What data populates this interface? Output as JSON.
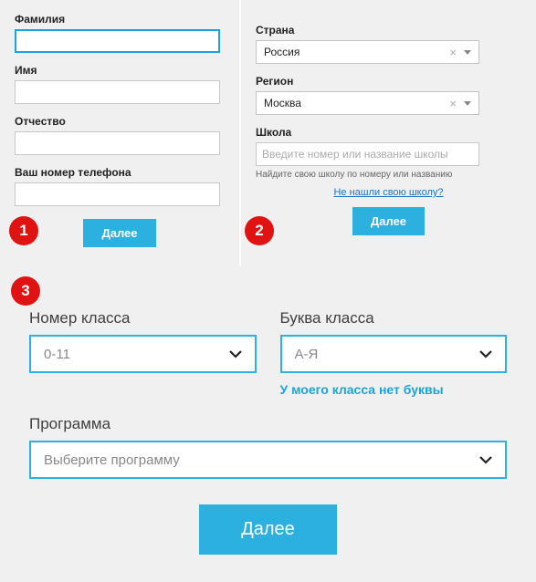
{
  "step1": {
    "surname_label": "Фамилия",
    "name_label": "Имя",
    "patronymic_label": "Отчество",
    "phone_label": "Ваш номер телефона",
    "next_btn": "Далее",
    "badge": "1"
  },
  "step2": {
    "country_label": "Страна",
    "country_value": "Россия",
    "region_label": "Регион",
    "region_value": "Москва",
    "school_label": "Школа",
    "school_placeholder": "Введите номер или название школы",
    "school_hint": "Найдите свою школу по номеру или названию",
    "not_found_link": "Не нашли свою школу?",
    "next_btn": "Далее",
    "badge": "2"
  },
  "step3": {
    "badge": "3",
    "class_num_label": "Номер класса",
    "class_num_value": "0-11",
    "class_letter_label": "Буква класса",
    "class_letter_value": "А-Я",
    "no_letter_link": "У моего класса нет буквы",
    "program_label": "Программа",
    "program_value": "Выберите программу",
    "next_btn": "Далее"
  }
}
